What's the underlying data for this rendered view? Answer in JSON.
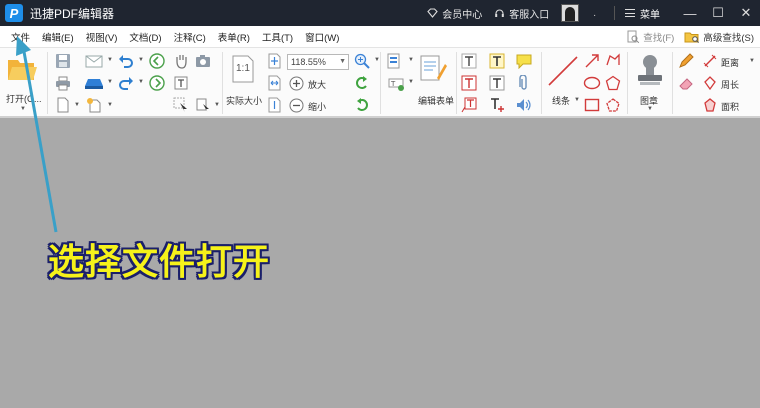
{
  "titlebar": {
    "logo_letter": "P",
    "title": "迅捷PDF编辑器",
    "member_center": "会员中心",
    "customer_service": "客服入口",
    "dot": ".",
    "menu_label": "菜单",
    "minimize": "—",
    "maximize": "☐",
    "close": "✕"
  },
  "menubar": {
    "items": [
      "文件",
      "编辑(E)",
      "视图(V)",
      "文档(D)",
      "注释(C)",
      "表单(R)",
      "工具(T)",
      "窗口(W)"
    ],
    "find": "查找(F)",
    "advanced_find": "高级查找(S)"
  },
  "toolbar": {
    "open_label": "打开(O...",
    "zoom_value": "118.55%",
    "actual_size_icon_text": "1:1",
    "actual_size_label": "实际大小",
    "zoom_in_label": "放大",
    "zoom_out_label": "缩小",
    "edit_form_label": "编辑表单",
    "line_label": "线条",
    "stamp_label": "图章",
    "distance_label": "距离",
    "perimeter_label": "周长",
    "area_label": "面积"
  },
  "annotation": {
    "text": "选择文件打开",
    "text_color": "#f6f21a",
    "outline_color": "#1a1f6a",
    "arrow_color": "#3aa0c8"
  }
}
